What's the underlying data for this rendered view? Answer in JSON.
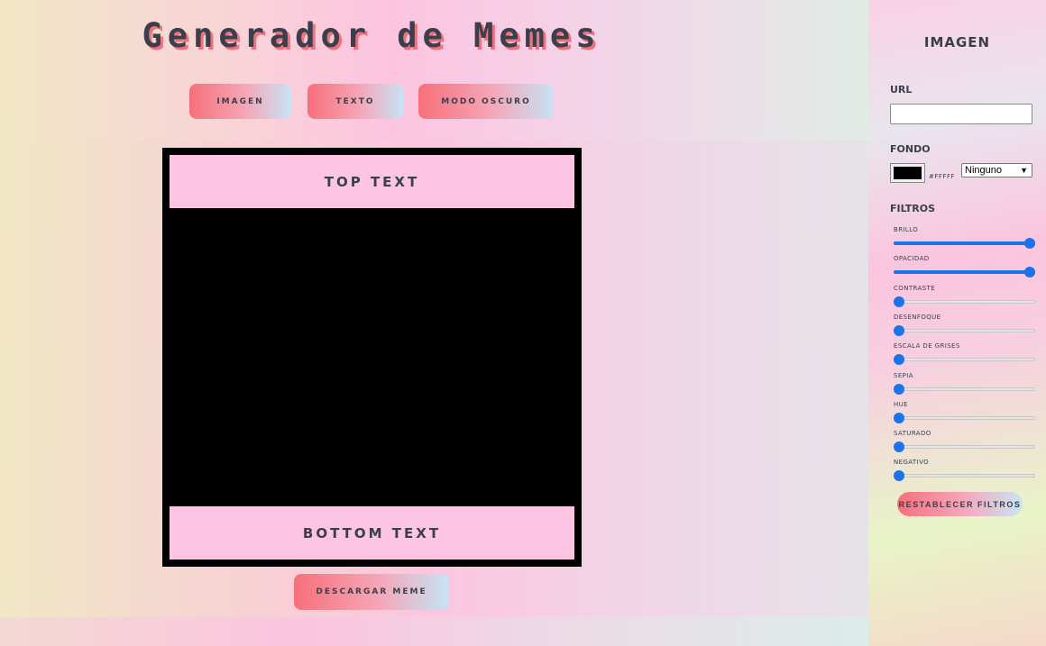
{
  "header": {
    "title": "Generador de Memes",
    "nav": {
      "imagen": "IMAGEN",
      "texto": "TEXTO",
      "modo_oscuro": "MODO OSCURO"
    }
  },
  "meme": {
    "top_text": "TOP TEXT",
    "bottom_text": "BOTTOM TEXT",
    "download_label": "DESCARGAR MEME"
  },
  "panel": {
    "title": "IMAGEN",
    "url_label": "URL",
    "url_value": "",
    "fondo_label": "FONDO",
    "fondo_color": "#000000",
    "fondo_hex_text": "#FFFFF",
    "blend_mode": "Ninguno",
    "filtros_label": "FILTROS",
    "filters": [
      {
        "label": "BRILLO",
        "value": 1.0
      },
      {
        "label": "OPACIDAD",
        "value": 1.0
      },
      {
        "label": "CONTRASTE",
        "value": 0.0
      },
      {
        "label": "DESENFOQUE",
        "value": 0.0
      },
      {
        "label": "ESCALA DE GRISES",
        "value": 0.0
      },
      {
        "label": "SEPIA",
        "value": 0.0
      },
      {
        "label": "HUE",
        "value": 0.0
      },
      {
        "label": "SATURADO",
        "value": 0.0
      },
      {
        "label": "NEGATIVO",
        "value": 0.0
      }
    ],
    "reset_label": "RESTABLECER FILTROS"
  },
  "colors": {
    "accent": "#1a73e8",
    "button_start": "#f7707a",
    "button_end": "#c6e3f5",
    "text": "#3a3f4b",
    "meme_text_bg": "#fdc4e4"
  }
}
